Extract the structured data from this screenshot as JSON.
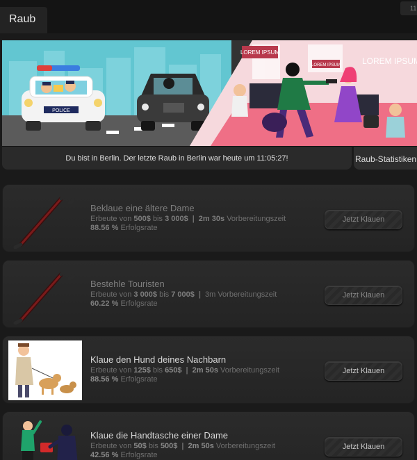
{
  "header": {
    "title": "Raub",
    "corner_tab": "11"
  },
  "banner": {
    "police_label": "POLICE",
    "sign1": "LOREM IPSUM",
    "sign2": "LOREM IPSUM",
    "sign3": "LOREM IPSUM"
  },
  "info": {
    "message": "Du bist in Berlin. Der letzte Raub in Berlin war heute um 11:05:27!",
    "stats_button": "Raub-Statistiken"
  },
  "robberies": [
    {
      "name": "Beklaue eine ältere Dame",
      "yield_prefix": "Erbeute von",
      "yield_from": "500$",
      "yield_mid": "bis",
      "yield_to": "3 000$",
      "prep_a": "2m",
      "prep_b": "30s",
      "prep_suffix": "Vorbereitungszeit",
      "rate": "88.56 %",
      "rate_suffix": "Erfolgsrate",
      "button": "Jetzt Klauen",
      "icon": "crowbar-icon"
    },
    {
      "name": "Bestehle Touristen",
      "yield_prefix": "Erbeute von",
      "yield_from": "3 000$",
      "yield_mid": "bis",
      "yield_to": "7 000$",
      "prep_a": "3m",
      "prep_b": "",
      "prep_suffix": "Vorbereitungszeit",
      "rate": "60.22 %",
      "rate_suffix": "Erfolgsrate",
      "button": "Jetzt Klauen",
      "icon": "crowbar-icon"
    },
    {
      "name": "Klaue den Hund deines Nachbarn",
      "yield_prefix": "Erbeute von",
      "yield_from": "125$",
      "yield_mid": "bis",
      "yield_to": "650$",
      "prep_a": "2m",
      "prep_b": "50s",
      "prep_suffix": "Vorbereitungszeit",
      "rate": "88.56 %",
      "rate_suffix": "Erfolgsrate",
      "button": "Jetzt Klauen",
      "icon": "dog-walker-icon"
    },
    {
      "name": "Klaue die Handtasche einer Dame",
      "yield_prefix": "Erbeute von",
      "yield_from": "50$",
      "yield_mid": "bis",
      "yield_to": "500$",
      "prep_a": "2m",
      "prep_b": "50s",
      "prep_suffix": "Vorbereitungszeit",
      "rate": "42.56 %",
      "rate_suffix": "Erfolgsrate",
      "button": "Jetzt Klauen",
      "icon": "handbag-thief-icon"
    }
  ],
  "colors": {
    "background": "#1a1a1a",
    "card": "#282828",
    "text_bright": "#d8d8d8",
    "text_dim": "#6f6f6f",
    "sky": "#5fc4cf",
    "pink": "#ef6f86"
  }
}
